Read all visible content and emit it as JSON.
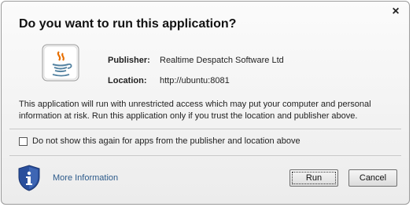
{
  "dialog": {
    "title": "Do you want to run this application?",
    "close_glyph": "×",
    "app_icon": "java-coffee-cup-icon"
  },
  "info": {
    "publisher_label": "Publisher:",
    "publisher_value": "Realtime Despatch Software Ltd",
    "location_label": "Location:",
    "location_value": "http://ubuntu:8081"
  },
  "warning_text": "This application will run with unrestricted access which may put your computer and personal information at risk. Run this application only if you trust the location and publisher above.",
  "checkbox": {
    "label": "Do not show this again for apps from the publisher and location above",
    "checked": false
  },
  "footer": {
    "info_icon": "shield-info-icon",
    "more_info_label": "More Information",
    "run_label": "Run",
    "cancel_label": "Cancel"
  },
  "colors": {
    "link": "#2c5a8a",
    "shield": "#2a4f9c"
  }
}
